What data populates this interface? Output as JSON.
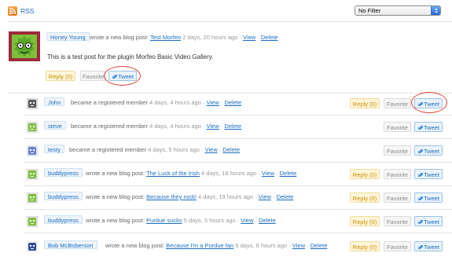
{
  "toolbar": {
    "rss_label": "RSS",
    "filter_value": "No Filter"
  },
  "featured": {
    "user": "Honey Young",
    "action": "wrote a new blog post:",
    "post_link": "Test Morfeo",
    "time": "2 days, 20 hours ago",
    "view": "View",
    "delete": "Delete",
    "content": "This is a test post for the plugin Morfeo Basic Video Gallery.",
    "reply": "Reply (0)",
    "favorite": "Favorite",
    "tweet": "Tweet"
  },
  "activities": [
    {
      "user": "John",
      "action": "became a registered member",
      "link": "",
      "time": "4 days, 4 hours ago",
      "view": "View",
      "delete": "Delete",
      "reply": "Reply (0)",
      "favorite": "Favorite",
      "tweet": "Tweet"
    },
    {
      "user": "steve",
      "action": "became a registered member",
      "link": "",
      "time": "4 days, 4 hours ago",
      "view": "View",
      "delete": "Delete",
      "reply": "",
      "favorite": "Favorite",
      "tweet": "Tweet"
    },
    {
      "user": "testy",
      "action": "became a registered member",
      "link": "",
      "time": "4 days, 5 hours ago",
      "view": "View",
      "delete": "Delete",
      "reply": "",
      "favorite": "Favorite",
      "tweet": "Tweet"
    },
    {
      "user": "buddypress",
      "action": "wrote a new blog post:",
      "link": "The Luck of the Irish",
      "time": "4 days, 18 hours ago",
      "view": "View",
      "delete": "Delete",
      "reply": "Reply (0)",
      "favorite": "Favorite",
      "tweet": "Tweet"
    },
    {
      "user": "buddypress",
      "action": "wrote a new blog post:",
      "link": "Because they rock!",
      "time": "4 days, 19 hours ago",
      "view": "View",
      "delete": "Delete",
      "reply": "Reply (0)",
      "favorite": "Favorite",
      "tweet": "Tweet"
    },
    {
      "user": "buddypress",
      "action": "wrote a new blog post:",
      "link": "Purdue sucks",
      "time": "5 days, 5 hours ago",
      "view": "View",
      "delete": "Delete",
      "reply": "Reply (0)",
      "favorite": "Favorite",
      "tweet": "Tweet"
    },
    {
      "user": "Bob McBoberson",
      "action": "wrote a new blog post:",
      "link": "Because I'm a Purdue fan",
      "time": "5 days, 6 hours ago",
      "view": "View",
      "delete": "Delete",
      "reply": "Reply (0)",
      "favorite": "Favorite",
      "tweet": "Tweet"
    }
  ],
  "colors": {
    "link": "#1b6ec2",
    "highlight_circle": "#d9453b",
    "reply_bg": "#fff6da",
    "tweet_bg": "#eaf3fc"
  },
  "icons": {
    "rss": "rss-feed-icon",
    "select": "select-arrows-icon",
    "tweet": "twitter-bird-icon"
  }
}
